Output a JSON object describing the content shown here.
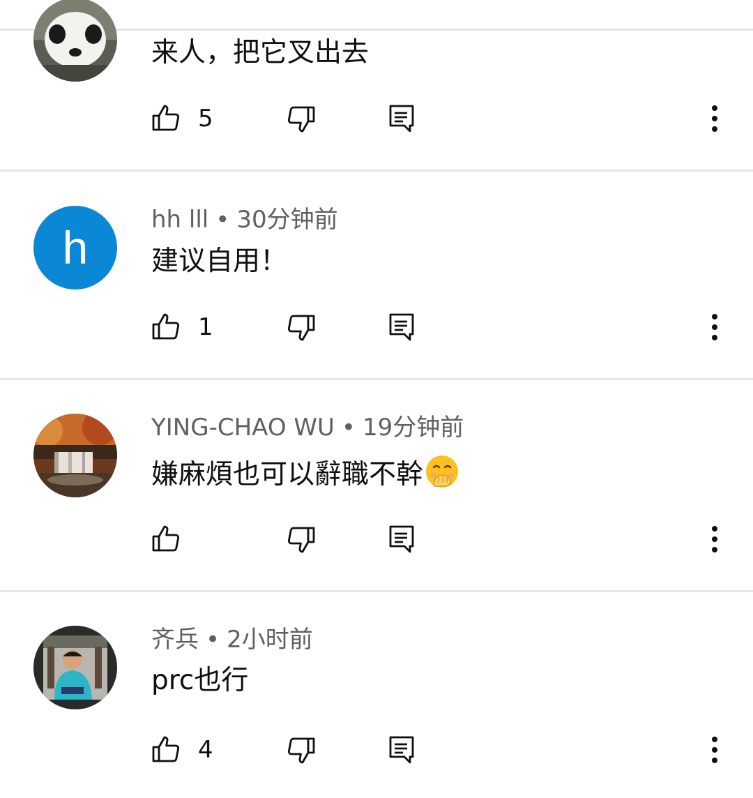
{
  "comments": [
    {
      "author": "",
      "time": "",
      "text": "来人，把它叉出去",
      "likes": "5",
      "avatar_icon": "panda-avatar-icon"
    },
    {
      "author": "hh lll",
      "time": "30分钟前",
      "text": "建议自用！",
      "likes": "1",
      "avatar_letter": "h",
      "avatar_color": "#0a88d6"
    },
    {
      "author": "YING-CHAO WU",
      "time": "19分钟前",
      "text": "嫌麻煩也可以辭職不幹",
      "likes": "",
      "avatar_icon": "waterfall-avatar-icon",
      "emoji_icon": "hand-over-mouth-emoji-icon"
    },
    {
      "author": "齐兵",
      "time": "2小时前",
      "text": "prc也行",
      "likes": "4",
      "avatar_icon": "person-photo-avatar-icon"
    }
  ],
  "meta_separator": "•",
  "icons": {
    "like": "thumb-up-icon",
    "dislike": "thumb-down-icon",
    "reply": "comment-reply-icon",
    "more": "more-vertical-icon"
  }
}
